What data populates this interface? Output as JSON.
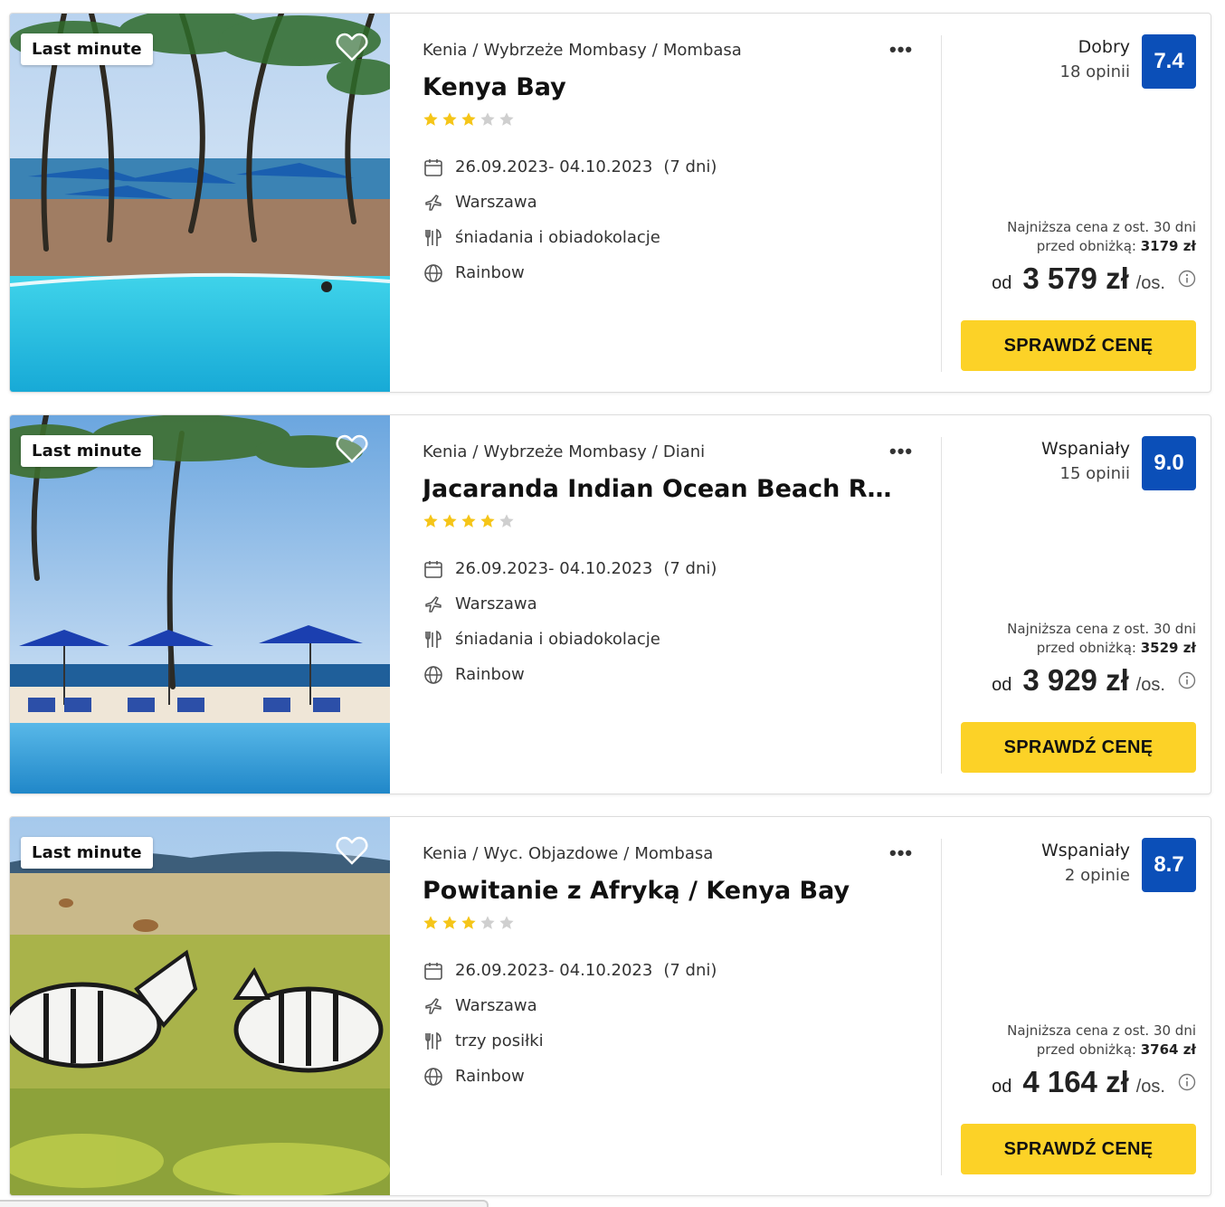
{
  "offers": [
    {
      "badge": "Last minute",
      "breadcrumb": [
        "Kenia",
        "Wybrzeże Mombasy",
        "Mombasa"
      ],
      "name": "Kenya Bay",
      "stars": 3,
      "dates": "26.09.2023- 04.10.2023",
      "duration": "(7 dni)",
      "departure": "Warszawa",
      "board": "śniadania i obiadokolacje",
      "operator": "Rainbow",
      "rating_word": "Dobry",
      "reviews": "18 opinii",
      "score": "7.4",
      "lowest_line1": "Najniższa cena z ost. 30 dni",
      "lowest_prefix": "przed obniżką: ",
      "lowest_value": "3179 zł",
      "price_prefix": "od",
      "price": "3 579 zł",
      "per": "/os.",
      "cta": "SPRAWDŹ CENĘ",
      "more": "•••"
    },
    {
      "badge": "Last minute",
      "breadcrumb": [
        "Kenia",
        "Wybrzeże Mombasy",
        "Diani"
      ],
      "name": "Jacaranda Indian Ocean Beach Resort",
      "stars": 4,
      "dates": "26.09.2023- 04.10.2023",
      "duration": "(7 dni)",
      "departure": "Warszawa",
      "board": "śniadania i obiadokolacje",
      "operator": "Rainbow",
      "rating_word": "Wspaniały",
      "reviews": "15 opinii",
      "score": "9.0",
      "lowest_line1": "Najniższa cena z ost. 30 dni",
      "lowest_prefix": "przed obniżką: ",
      "lowest_value": "3529 zł",
      "price_prefix": "od",
      "price": "3 929 zł",
      "per": "/os.",
      "cta": "SPRAWDŹ CENĘ",
      "more": "•••"
    },
    {
      "badge": "Last minute",
      "breadcrumb": [
        "Kenia",
        "Wyc. Objazdowe",
        "Mombasa"
      ],
      "name": "Powitanie z Afryką / Kenya Bay",
      "stars": 3,
      "dates": "26.09.2023- 04.10.2023",
      "duration": "(7 dni)",
      "departure": "Warszawa",
      "board": "trzy posiłki",
      "operator": "Rainbow",
      "rating_word": "Wspaniały",
      "reviews": "2 opinie",
      "score": "8.7",
      "lowest_line1": "Najniższa cena z ost. 30 dni",
      "lowest_prefix": "przed obniżką: ",
      "lowest_value": "3764 zł",
      "price_prefix": "od",
      "price": "4 164 zł",
      "per": "/os.",
      "cta": "SPRAWDŹ CENĘ",
      "more": "•••"
    }
  ],
  "colors": {
    "score_bg": "#0b4fb8",
    "cta_bg": "#fcd227",
    "star_on": "#f5c518",
    "star_off": "#cfcfcf"
  },
  "icons": {
    "dates": "calendar-icon",
    "departure": "plane-icon",
    "board": "cutlery-icon",
    "operator": "globe-icon",
    "favorite": "heart-icon",
    "price_info": "info-icon",
    "more": "more-dots-icon"
  }
}
